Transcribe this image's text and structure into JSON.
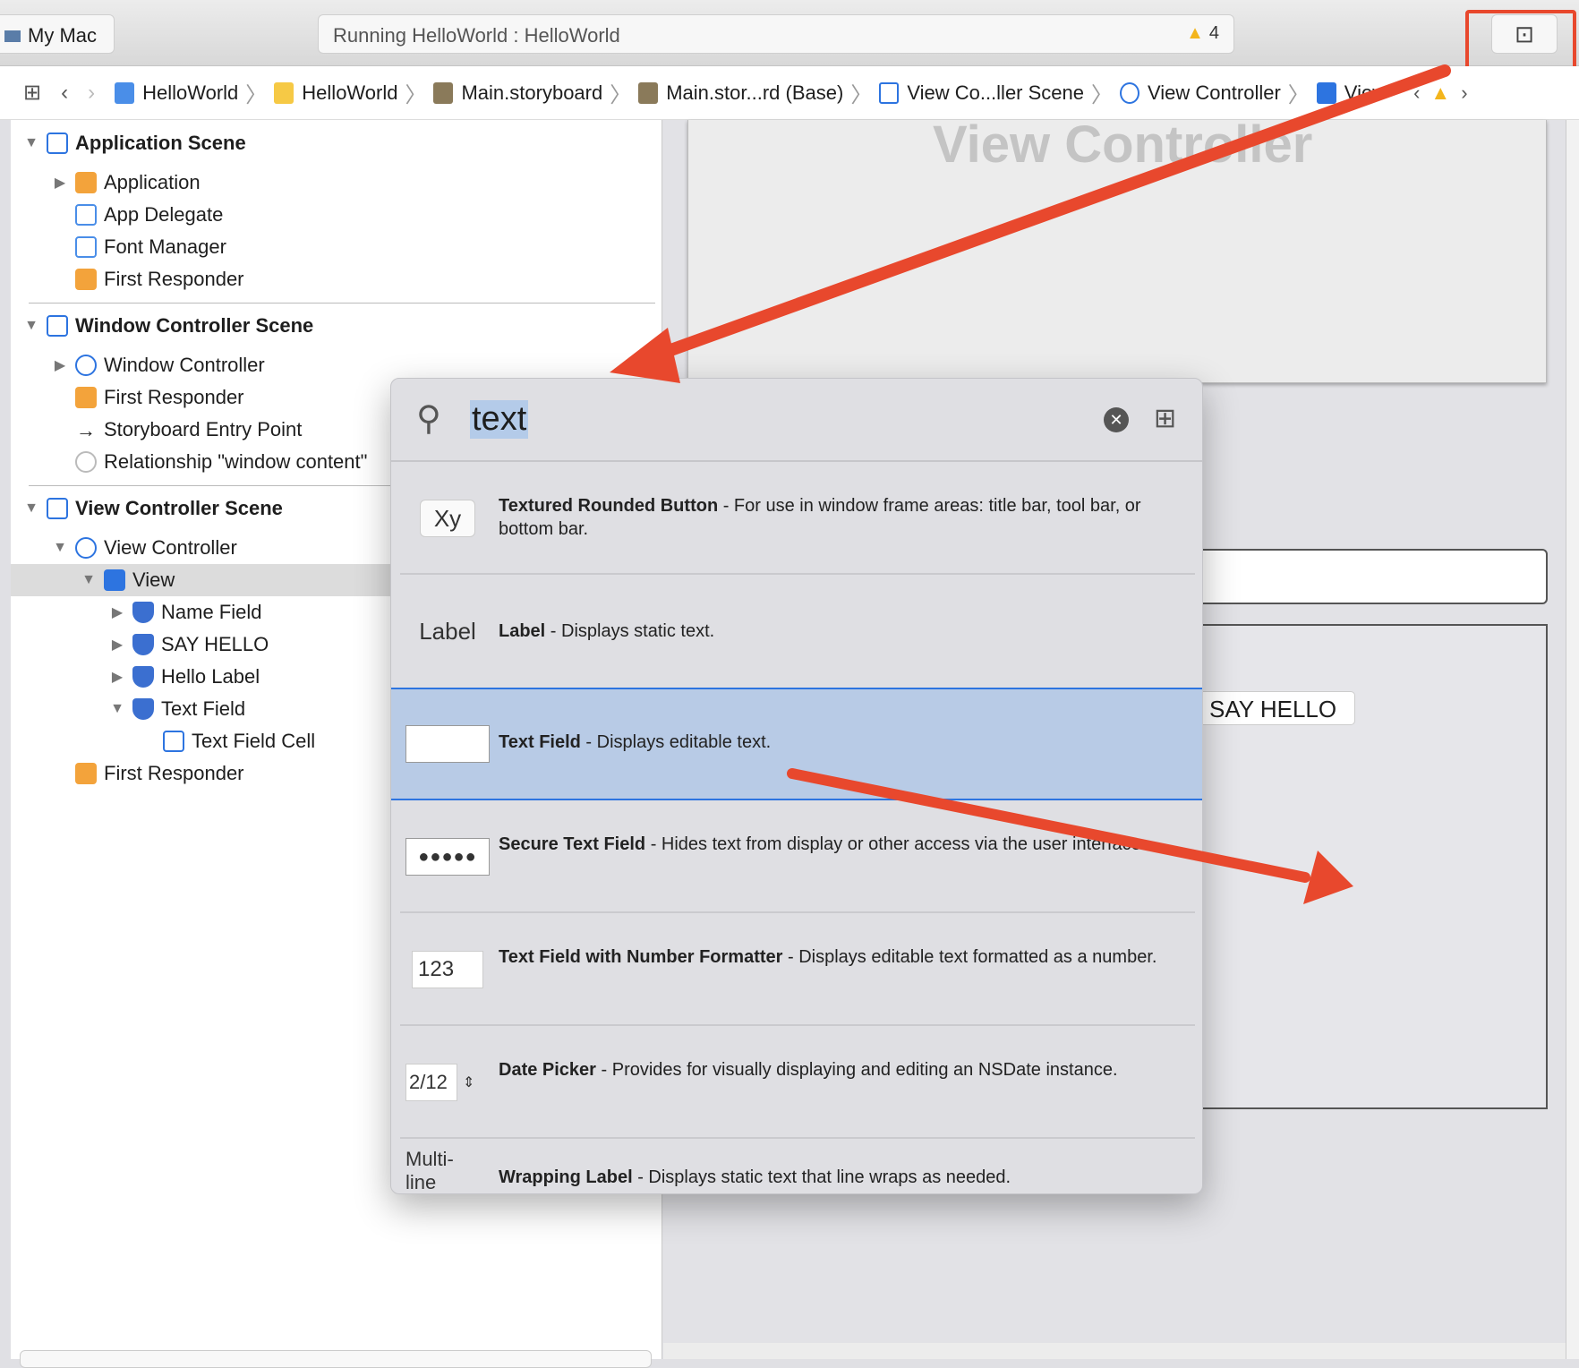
{
  "toolbar": {
    "scheme": "My Mac",
    "activity": "Running HelloWorld : HelloWorld",
    "warning_count": "4",
    "debug_icon": "view-debugger-icon"
  },
  "jumpbar": {
    "crumbs": [
      "HelloWorld",
      "HelloWorld",
      "Main.storyboard",
      "Main.stor...rd (Base)",
      "View Co...ller Scene",
      "View Controller",
      "View"
    ]
  },
  "outline": {
    "rows": [
      "Application Scene",
      "Application",
      "App Delegate",
      "Font Manager",
      "First Responder",
      "Window Controller Scene",
      "Window Controller",
      "First Responder",
      "Storyboard Entry Point",
      "Relationship \"window content\"",
      "View Controller Scene",
      "View Controller",
      "View",
      "Name Field",
      "SAY HELLO",
      "Hello Label",
      "Text Field",
      "Text Field Cell",
      "First Responder"
    ]
  },
  "canvas": {
    "title": "View Controller",
    "button": "SAY HELLO"
  },
  "library": {
    "query": "text",
    "items": [
      {
        "thumb": "Xy",
        "name": "Textured Rounded Button",
        "desc": " - For use in window frame areas: title bar, tool bar, or bottom bar."
      },
      {
        "thumb": "Label",
        "name": "Label",
        "desc": " - Displays static text."
      },
      {
        "thumb": "",
        "name": "Text Field",
        "desc": " - Displays editable text."
      },
      {
        "thumb": "●●●●●",
        "name": "Secure Text Field",
        "desc": " - Hides text from display or other access via the user interface."
      },
      {
        "thumb": "123",
        "name": "Text Field with Number Formatter",
        "desc": " - Displays editable text formatted as a number."
      },
      {
        "thumb": "2/12",
        "name": "Date Picker",
        "desc": " - Provides for visually displaying and editing an NSDate instance."
      },
      {
        "thumb": "Multi-line",
        "name": "Wrapping Label",
        "desc": " - Displays static text that line wraps as needed."
      }
    ],
    "selected_index": 2
  },
  "annotation_color": "#e8482d"
}
